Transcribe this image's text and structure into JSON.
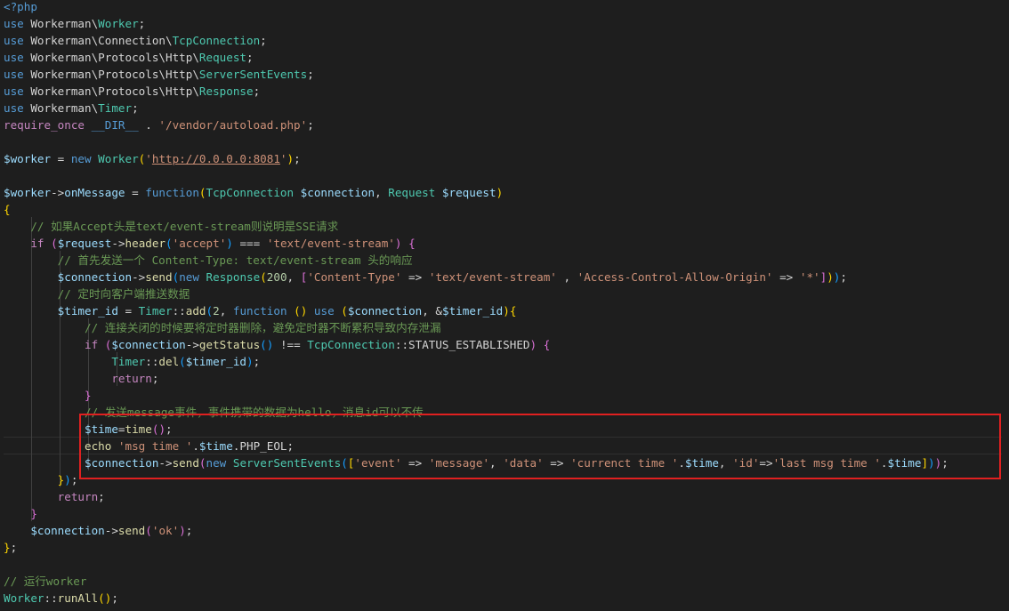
{
  "editor": {
    "language": "php",
    "highlight_color": "#e02020",
    "lines": [
      [
        [
          "kw",
          "<?php"
        ]
      ],
      [
        [
          "kw",
          "use "
        ],
        [
          "pun",
          "Workerman\\"
        ],
        [
          "cls",
          "Worker"
        ],
        [
          "pun",
          ";"
        ]
      ],
      [
        [
          "kw",
          "use "
        ],
        [
          "pun",
          "Workerman\\Connection\\"
        ],
        [
          "cls",
          "TcpConnection"
        ],
        [
          "pun",
          ";"
        ]
      ],
      [
        [
          "kw",
          "use "
        ],
        [
          "pun",
          "Workerman\\Protocols\\Http\\"
        ],
        [
          "cls",
          "Request"
        ],
        [
          "pun",
          ";"
        ]
      ],
      [
        [
          "kw",
          "use "
        ],
        [
          "pun",
          "Workerman\\Protocols\\Http\\"
        ],
        [
          "cls",
          "ServerSentEvents"
        ],
        [
          "pun",
          ";"
        ]
      ],
      [
        [
          "kw",
          "use "
        ],
        [
          "pun",
          "Workerman\\Protocols\\Http\\"
        ],
        [
          "cls",
          "Response"
        ],
        [
          "pun",
          ";"
        ]
      ],
      [
        [
          "kw",
          "use "
        ],
        [
          "pun",
          "Workerman\\"
        ],
        [
          "cls",
          "Timer"
        ],
        [
          "pun",
          ";"
        ]
      ],
      [
        [
          "ctl",
          "require_once "
        ],
        [
          "kw",
          "__DIR__"
        ],
        [
          "pun",
          " . "
        ],
        [
          "str",
          "'/vendor/autoload.php'"
        ],
        [
          "pun",
          ";"
        ]
      ],
      [],
      [
        [
          "var",
          "$worker"
        ],
        [
          "pun",
          " = "
        ],
        [
          "kw",
          "new "
        ],
        [
          "cls",
          "Worker"
        ],
        [
          "brk1",
          "("
        ],
        [
          "str",
          "'"
        ],
        [
          "str u",
          "http://0.0.0.0:8081"
        ],
        [
          "str",
          "'"
        ],
        [
          "brk1",
          ")"
        ],
        [
          "pun",
          ";"
        ]
      ],
      [],
      [
        [
          "var",
          "$worker"
        ],
        [
          "pun",
          "->"
        ],
        [
          "var",
          "onMessage"
        ],
        [
          "pun",
          " = "
        ],
        [
          "kw",
          "function"
        ],
        [
          "brk1",
          "("
        ],
        [
          "cls",
          "TcpConnection "
        ],
        [
          "var",
          "$connection"
        ],
        [
          "pun",
          ", "
        ],
        [
          "cls",
          "Request "
        ],
        [
          "var",
          "$request"
        ],
        [
          "brk1",
          ")"
        ]
      ],
      [
        [
          "brk1",
          "{"
        ]
      ],
      [
        [
          "pun",
          "    "
        ],
        [
          "com",
          "// 如果Accept头是text/event-stream则说明是SSE请求"
        ]
      ],
      [
        [
          "pun",
          "    "
        ],
        [
          "ctl",
          "if "
        ],
        [
          "brk2",
          "("
        ],
        [
          "var",
          "$request"
        ],
        [
          "pun",
          "->"
        ],
        [
          "fn",
          "header"
        ],
        [
          "brk3",
          "("
        ],
        [
          "str",
          "'accept'"
        ],
        [
          "brk3",
          ")"
        ],
        [
          "pun",
          " === "
        ],
        [
          "str",
          "'text/event-stream'"
        ],
        [
          "brk2",
          ")"
        ],
        [
          "pun",
          " "
        ],
        [
          "brk2",
          "{"
        ]
      ],
      [
        [
          "pun",
          "        "
        ],
        [
          "com",
          "// 首先发送一个 Content-Type: text/event-stream 头的响应"
        ]
      ],
      [
        [
          "pun",
          "        "
        ],
        [
          "var",
          "$connection"
        ],
        [
          "pun",
          "->"
        ],
        [
          "fn",
          "send"
        ],
        [
          "brk3",
          "("
        ],
        [
          "kw",
          "new "
        ],
        [
          "cls",
          "Response"
        ],
        [
          "brk1",
          "("
        ],
        [
          "num",
          "200"
        ],
        [
          "pun",
          ", "
        ],
        [
          "brk2",
          "["
        ],
        [
          "str",
          "'Content-Type'"
        ],
        [
          "pun",
          " => "
        ],
        [
          "str",
          "'text/event-stream'"
        ],
        [
          "pun",
          " , "
        ],
        [
          "str",
          "'Access-Control-Allow-Origin'"
        ],
        [
          "pun",
          " => "
        ],
        [
          "str",
          "'*'"
        ],
        [
          "brk2",
          "]"
        ],
        [
          "brk1",
          ")"
        ],
        [
          "brk3",
          ")"
        ],
        [
          "pun",
          ";"
        ]
      ],
      [
        [
          "pun",
          "        "
        ],
        [
          "com",
          "// 定时向客户端推送数据"
        ]
      ],
      [
        [
          "pun",
          "        "
        ],
        [
          "var",
          "$timer_id"
        ],
        [
          "pun",
          " = "
        ],
        [
          "cls",
          "Timer"
        ],
        [
          "pun",
          "::"
        ],
        [
          "fn",
          "add"
        ],
        [
          "brk3",
          "("
        ],
        [
          "num",
          "2"
        ],
        [
          "pun",
          ", "
        ],
        [
          "kw",
          "function "
        ],
        [
          "brk1",
          "("
        ],
        [
          "brk1",
          ")"
        ],
        [
          "pun",
          " "
        ],
        [
          "kw",
          "use "
        ],
        [
          "brk1",
          "("
        ],
        [
          "var",
          "$connection"
        ],
        [
          "pun",
          ", &"
        ],
        [
          "var",
          "$timer_id"
        ],
        [
          "brk1",
          ")"
        ],
        [
          "brk1",
          "{"
        ]
      ],
      [
        [
          "pun",
          "            "
        ],
        [
          "com",
          "// 连接关闭的时候要将定时器删除，避免定时器不断累积导致内存泄漏"
        ]
      ],
      [
        [
          "pun",
          "            "
        ],
        [
          "ctl",
          "if "
        ],
        [
          "brk2",
          "("
        ],
        [
          "var",
          "$connection"
        ],
        [
          "pun",
          "->"
        ],
        [
          "fn",
          "getStatus"
        ],
        [
          "brk3",
          "("
        ],
        [
          "brk3",
          ")"
        ],
        [
          "pun",
          " !== "
        ],
        [
          "cls",
          "TcpConnection"
        ],
        [
          "pun",
          "::STATUS_ESTABLISHED"
        ],
        [
          "brk2",
          ")"
        ],
        [
          "pun",
          " "
        ],
        [
          "brk2",
          "{"
        ]
      ],
      [
        [
          "pun",
          "                "
        ],
        [
          "cls",
          "Timer"
        ],
        [
          "pun",
          "::"
        ],
        [
          "fn",
          "del"
        ],
        [
          "brk3",
          "("
        ],
        [
          "var",
          "$timer_id"
        ],
        [
          "brk3",
          ")"
        ],
        [
          "pun",
          ";"
        ]
      ],
      [
        [
          "pun",
          "                "
        ],
        [
          "ctl",
          "return"
        ],
        [
          "pun",
          ";"
        ]
      ],
      [
        [
          "pun",
          "            "
        ],
        [
          "brk2",
          "}"
        ]
      ],
      [
        [
          "pun",
          "            "
        ],
        [
          "com",
          "// 发送message事件，事件携带的数据为hello，消息id可以不传"
        ]
      ],
      [
        [
          "pun",
          "            "
        ],
        [
          "var",
          "$time"
        ],
        [
          "pun",
          "="
        ],
        [
          "fn",
          "time"
        ],
        [
          "brk2",
          "("
        ],
        [
          "brk2",
          ")"
        ],
        [
          "pun",
          ";"
        ]
      ],
      [
        [
          "pun",
          "            "
        ],
        [
          "fn",
          "echo "
        ],
        [
          "str",
          "'msg time '"
        ],
        [
          "pun",
          "."
        ],
        [
          "var",
          "$time"
        ],
        [
          "pun",
          ".PHP_EOL;"
        ]
      ],
      [
        [
          "pun",
          "            "
        ],
        [
          "var",
          "$connection"
        ],
        [
          "pun",
          "->"
        ],
        [
          "fn",
          "send"
        ],
        [
          "brk2",
          "("
        ],
        [
          "kw",
          "new "
        ],
        [
          "cls",
          "ServerSentEvents"
        ],
        [
          "brk3",
          "("
        ],
        [
          "brk1",
          "["
        ],
        [
          "str",
          "'event'"
        ],
        [
          "pun",
          " => "
        ],
        [
          "str",
          "'message'"
        ],
        [
          "pun",
          ", "
        ],
        [
          "str",
          "'data'"
        ],
        [
          "pun",
          " => "
        ],
        [
          "str",
          "'currenct time '"
        ],
        [
          "pun",
          "."
        ],
        [
          "var",
          "$time"
        ],
        [
          "pun",
          ", "
        ],
        [
          "str",
          "'id'"
        ],
        [
          "pun",
          "=>"
        ],
        [
          "str",
          "'last msg time '"
        ],
        [
          "pun",
          "."
        ],
        [
          "var",
          "$time"
        ],
        [
          "brk1",
          "]"
        ],
        [
          "brk3",
          ")"
        ],
        [
          "brk2",
          ")"
        ],
        [
          "pun",
          ";"
        ]
      ],
      [
        [
          "pun",
          "        "
        ],
        [
          "brk1",
          "}"
        ],
        [
          "brk3",
          ")"
        ],
        [
          "pun",
          ";"
        ]
      ],
      [
        [
          "pun",
          "        "
        ],
        [
          "ctl",
          "return"
        ],
        [
          "pun",
          ";"
        ]
      ],
      [
        [
          "pun",
          "    "
        ],
        [
          "brk2",
          "}"
        ]
      ],
      [
        [
          "pun",
          "    "
        ],
        [
          "var",
          "$connection"
        ],
        [
          "pun",
          "->"
        ],
        [
          "fn",
          "send"
        ],
        [
          "brk2",
          "("
        ],
        [
          "str",
          "'ok'"
        ],
        [
          "brk2",
          ")"
        ],
        [
          "pun",
          ";"
        ]
      ],
      [
        [
          "brk1",
          "}"
        ],
        [
          "pun",
          ";"
        ]
      ],
      [],
      [
        [
          "com",
          "// 运行worker"
        ]
      ],
      [
        [
          "cls",
          "Worker"
        ],
        [
          "pun",
          "::"
        ],
        [
          "fn",
          "runAll"
        ],
        [
          "brk1",
          "("
        ],
        [
          "brk1",
          ")"
        ],
        [
          "pun",
          ";"
        ]
      ]
    ]
  }
}
